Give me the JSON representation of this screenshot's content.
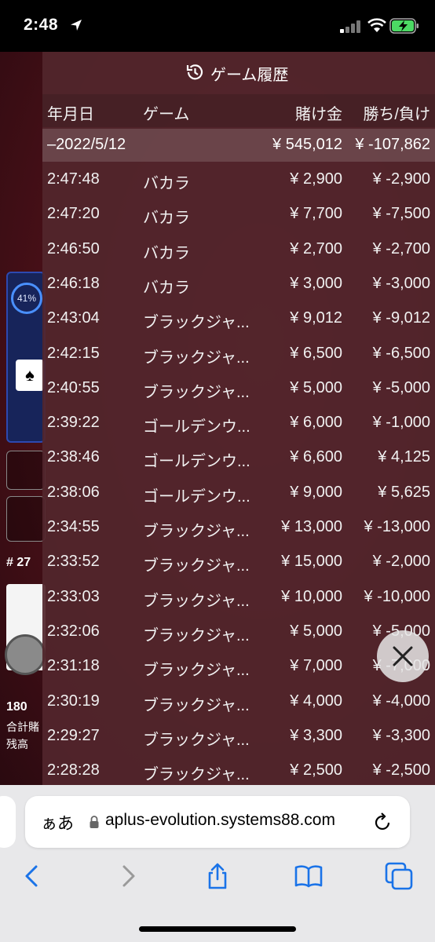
{
  "status_bar": {
    "time": "2:48"
  },
  "background": {
    "percent": "41%",
    "round_number": "# 27",
    "players": "180",
    "total_bet_label": "合計賭",
    "balance_label": "残高"
  },
  "history": {
    "title": "ゲーム履歴",
    "columns": {
      "date": "年月日",
      "game": "ゲーム",
      "bet": "賭け金",
      "win": "勝ち/負け"
    },
    "summary": {
      "date": "–2022/5/12",
      "bet": "¥ 545,012",
      "win": "¥ -107,862"
    },
    "rows": [
      {
        "time": "2:47:48",
        "game": "バカラ",
        "bet": "¥ 2,900",
        "win": "¥ -2,900"
      },
      {
        "time": "2:47:20",
        "game": "バカラ",
        "bet": "¥ 7,700",
        "win": "¥ -7,500"
      },
      {
        "time": "2:46:50",
        "game": "バカラ",
        "bet": "¥ 2,700",
        "win": "¥ -2,700"
      },
      {
        "time": "2:46:18",
        "game": "バカラ",
        "bet": "¥ 3,000",
        "win": "¥ -3,000"
      },
      {
        "time": "2:43:04",
        "game": "ブラックジャ...",
        "bet": "¥ 9,012",
        "win": "¥ -9,012"
      },
      {
        "time": "2:42:15",
        "game": "ブラックジャ...",
        "bet": "¥ 6,500",
        "win": "¥ -6,500"
      },
      {
        "time": "2:40:55",
        "game": "ブラックジャ...",
        "bet": "¥ 5,000",
        "win": "¥ -5,000"
      },
      {
        "time": "2:39:22",
        "game": "ゴールデンウ...",
        "bet": "¥ 6,000",
        "win": "¥ -1,000"
      },
      {
        "time": "2:38:46",
        "game": "ゴールデンウ...",
        "bet": "¥ 6,600",
        "win": "¥ 4,125"
      },
      {
        "time": "2:38:06",
        "game": "ゴールデンウ...",
        "bet": "¥ 9,000",
        "win": "¥ 5,625"
      },
      {
        "time": "2:34:55",
        "game": "ブラックジャ...",
        "bet": "¥ 13,000",
        "win": "¥ -13,000"
      },
      {
        "time": "2:33:52",
        "game": "ブラックジャ...",
        "bet": "¥ 15,000",
        "win": "¥ -2,000"
      },
      {
        "time": "2:33:03",
        "game": "ブラックジャ...",
        "bet": "¥ 10,000",
        "win": "¥ -10,000"
      },
      {
        "time": "2:32:06",
        "game": "ブラックジャ...",
        "bet": "¥ 5,000",
        "win": "¥ -5,000"
      },
      {
        "time": "2:31:18",
        "game": "ブラックジャ...",
        "bet": "¥ 7,000",
        "win": "¥ -7,000"
      },
      {
        "time": "2:30:19",
        "game": "ブラックジャ...",
        "bet": "¥ 4,000",
        "win": "¥ -4,000"
      },
      {
        "time": "2:29:27",
        "game": "ブラックジャ...",
        "bet": "¥ 3,300",
        "win": "¥ -3,300"
      },
      {
        "time": "2:28:28",
        "game": "ブラックジャ...",
        "bet": "¥ 2,500",
        "win": "¥ -2,500"
      }
    ]
  },
  "browser": {
    "aa_label": "ぁあ",
    "url": "aplus-evolution.systems88.com"
  },
  "colors": {
    "accent": "#1a73e8",
    "overlay": "#52262c"
  }
}
